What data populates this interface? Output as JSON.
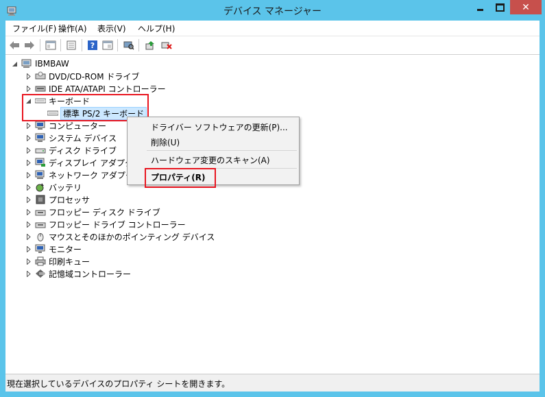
{
  "window": {
    "title": "デバイス マネージャー",
    "close_glyph": "✕",
    "accent_color": "#5bc4ea",
    "close_color": "#c7504c"
  },
  "menubar": {
    "file": "ファイル(F)",
    "action": "操作(A)",
    "view": "表示(V)",
    "help": "ヘルプ(H)"
  },
  "toolbar": {
    "buttons": [
      "back-icon",
      "forward-icon",
      "show-hide-tree-icon",
      "properties-icon",
      "help-icon",
      "view-icon",
      "scan-hardware-icon",
      "update-driver-icon",
      "uninstall-icon"
    ]
  },
  "tree": {
    "root": "IBMBAW",
    "items": [
      {
        "label": "DVD/CD-ROM ドライブ",
        "icon": "dvd-drive-icon"
      },
      {
        "label": "IDE ATA/ATAPI コントローラー",
        "icon": "ide-controller-icon"
      },
      {
        "label": "キーボード",
        "icon": "keyboard-icon",
        "expanded": true
      },
      {
        "label": "標準 PS/2 キーボード",
        "icon": "keyboard-icon",
        "child": true
      },
      {
        "label": "コンピューター",
        "icon": "computer-icon"
      },
      {
        "label": "システム デバイス",
        "icon": "system-device-icon"
      },
      {
        "label": "ディスク ドライブ",
        "icon": "disk-drive-icon"
      },
      {
        "label": "ディスプレイ アダプター",
        "icon": "display-adapter-icon"
      },
      {
        "label": "ネットワーク アダプター",
        "icon": "network-adapter-icon"
      },
      {
        "label": "バッテリ",
        "icon": "battery-icon"
      },
      {
        "label": "プロセッサ",
        "icon": "processor-icon"
      },
      {
        "label": "フロッピー ディスク ドライブ",
        "icon": "floppy-drive-icon"
      },
      {
        "label": "フロッピー ドライブ コントローラー",
        "icon": "floppy-controller-icon"
      },
      {
        "label": "マウスとそのほかのポインティング デバイス",
        "icon": "mouse-icon"
      },
      {
        "label": "モニター",
        "icon": "monitor-icon"
      },
      {
        "label": "印刷キュー",
        "icon": "printer-icon"
      },
      {
        "label": "記憶域コントローラー",
        "icon": "storage-controller-icon"
      }
    ]
  },
  "context_menu": {
    "update_driver": "ドライバー ソフトウェアの更新(P)...",
    "uninstall": "削除(U)",
    "scan": "ハードウェア変更のスキャン(A)",
    "properties": "プロパティ(R)"
  },
  "statusbar": {
    "text": "現在選択しているデバイスのプロパティ シートを開きます。"
  },
  "highlight_color": "#e8141e"
}
